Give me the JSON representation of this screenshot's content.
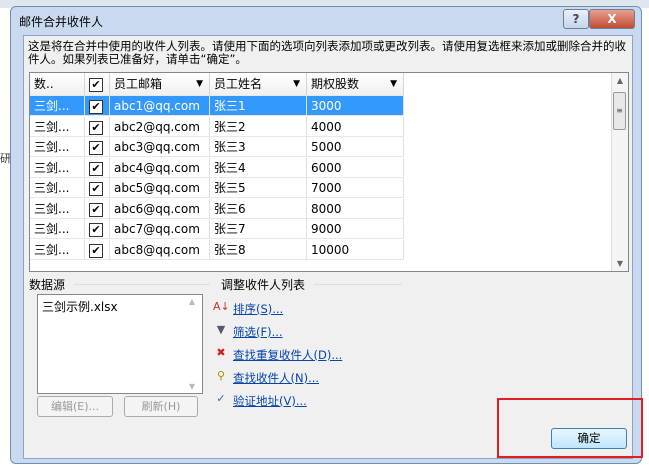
{
  "dialog": {
    "title": "邮件合并收件人",
    "help": "?",
    "close": "X",
    "description": "这是将在合并中使用的收件人列表。请使用下面的选项向列表添加项或更改列表。请使用复选框来添加或删除合并的收件人。如果列表已准备好，请单击“确定”。"
  },
  "background": {
    "side_text": "研究"
  },
  "grid": {
    "headers": [
      "数..",
      "",
      "员工邮箱",
      "员工姓名",
      "期权股数"
    ],
    "rows": [
      {
        "source": "三剑...",
        "checked": true,
        "email": "abc1@qq.com",
        "name": "张三1",
        "shares": "3000"
      },
      {
        "source": "三剑...",
        "checked": true,
        "email": "abc2@qq.com",
        "name": "张三2",
        "shares": "4000"
      },
      {
        "source": "三剑...",
        "checked": true,
        "email": "abc3@qq.com",
        "name": "张三3",
        "shares": "5000"
      },
      {
        "source": "三剑...",
        "checked": true,
        "email": "abc4@qq.com",
        "name": "张三4",
        "shares": "6000"
      },
      {
        "source": "三剑...",
        "checked": true,
        "email": "abc5@qq.com",
        "name": "张三5",
        "shares": "7000"
      },
      {
        "source": "三剑...",
        "checked": true,
        "email": "abc6@qq.com",
        "name": "张三6",
        "shares": "8000"
      },
      {
        "source": "三剑...",
        "checked": true,
        "email": "abc7@qq.com",
        "name": "张三7",
        "shares": "9000"
      },
      {
        "source": "三剑...",
        "checked": true,
        "email": "abc8@qq.com",
        "name": "张三8",
        "shares": "10000"
      }
    ]
  },
  "datasource": {
    "label": "数据源",
    "items": [
      "三剑示例.xlsx"
    ],
    "edit": "编辑(E)...",
    "refresh": "刷新(H)"
  },
  "adjust": {
    "label": "调整收件人列表",
    "links": [
      "排序(S)...",
      "筛选(F)...",
      "查找重复收件人(D)...",
      "查找收件人(N)...",
      "验证地址(V)..."
    ]
  },
  "ok": "确定"
}
